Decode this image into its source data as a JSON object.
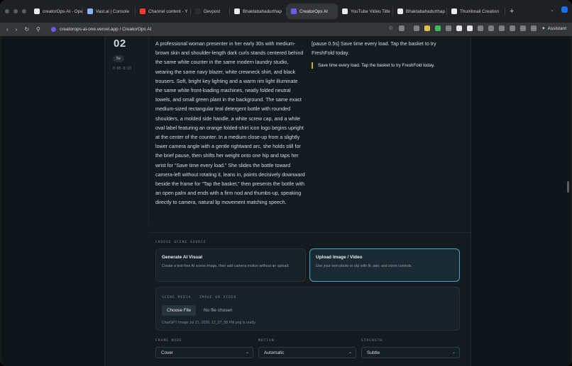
{
  "browser": {
    "tabs": [
      {
        "label": "creatorOps-AI - Ope",
        "icon": "github-icon",
        "color": "#e8eaed"
      },
      {
        "label": "Vast.ai | Console",
        "icon": "vastai-icon",
        "color": "#8ab4f8"
      },
      {
        "label": "Channel content - Y",
        "icon": "youtube-icon",
        "color": "#ff3b30"
      },
      {
        "label": "Devpost",
        "icon": "devpost-icon",
        "color": "#2c2c2c"
      },
      {
        "label": "Bhaktabahadurthap",
        "icon": "github-icon",
        "color": "#e8eaed"
      },
      {
        "label": "CreatorOps AI",
        "icon": "creatorops-icon",
        "color": "#6b5cf6",
        "active": true
      },
      {
        "label": "YouTube Video Title",
        "icon": "chatgpt-icon",
        "color": "#e8eaed"
      },
      {
        "label": "Bhaktabahadurthap",
        "icon": "github-icon",
        "color": "#e8eaed"
      },
      {
        "label": "Thumbnail Creation",
        "icon": "chatgpt-icon",
        "color": "#e8eaed"
      }
    ],
    "new_tab": "+",
    "url": "creatorops-ai-one.vercel.app / CreatorOps AI",
    "assistant_label": "Assistant"
  },
  "scene": {
    "number": "02",
    "duration": "5s",
    "range": "0:05-0:10",
    "prompt": "A professional woman presenter in her early 30s with medium-brown skin and shoulder-length dark curls stands centered behind the same white counter in the same modern laundry studio, wearing the same navy blazer, white crewneck shirt, and black trousers. Soft, bright key lighting and a warm rim light illuminate the same white front-loading machines, neatly folded neutral towels, and small green plant in the background. The same exact medium-sized rectangular teal detergent bottle with rounded shoulders, a molded side handle, a white screw cap, and a white oval label featuring an orange folded-shirt icon logo begins upright at the center of the counter. In a medium close-up from a slightly lower camera angle with a gentle rightward arc, she holds still for the brief pause, then shifts her weight onto one hip and taps her wrist for “Save time every load.” She slides the bottle toward camera-left without rotating it, leans in, points decisively downward beside the frame for “Tap the basket,” then presents the bottle with an open palm and ends with a firm nod and thumbs-up, speaking directly to camera, natural lip movement matching speech.",
    "voiceover_script": "[pause 0.5s] Save time every load. Tap the basket to try FreshFold today.",
    "voiceover_quote": "Save time every load. Tap the basket to try FreshFold today."
  },
  "source": {
    "section_label": "CHOOSE SCENE SOURCE",
    "options": [
      {
        "title": "Generate AI Visual",
        "desc": "Create a text-free AI scene image, then add camera motion without an upload.",
        "selected": false
      },
      {
        "title": "Upload Image / Video",
        "desc": "Use your own photo or clip with fit, pan, and zoom controls.",
        "selected": true
      }
    ]
  },
  "media": {
    "section_label": "SCENE MEDIA · IMAGE OR VIDEO",
    "choose_label": "Choose File",
    "no_file": "No file chosen",
    "info": "ChatGPT Image Jul 21, 2026, 12_07_58 PM.png is ready"
  },
  "controls": {
    "frame_mode": {
      "label": "FRAME MODE",
      "value": "Cover"
    },
    "motion": {
      "label": "MOTION",
      "value": "Automatic"
    },
    "strength": {
      "label": "STRENGTH",
      "value": "Subtle"
    }
  },
  "colors": {
    "accent": "#4aa3c8",
    "quote_bar": "#d4a64a",
    "page_bg": "#0f161a"
  }
}
